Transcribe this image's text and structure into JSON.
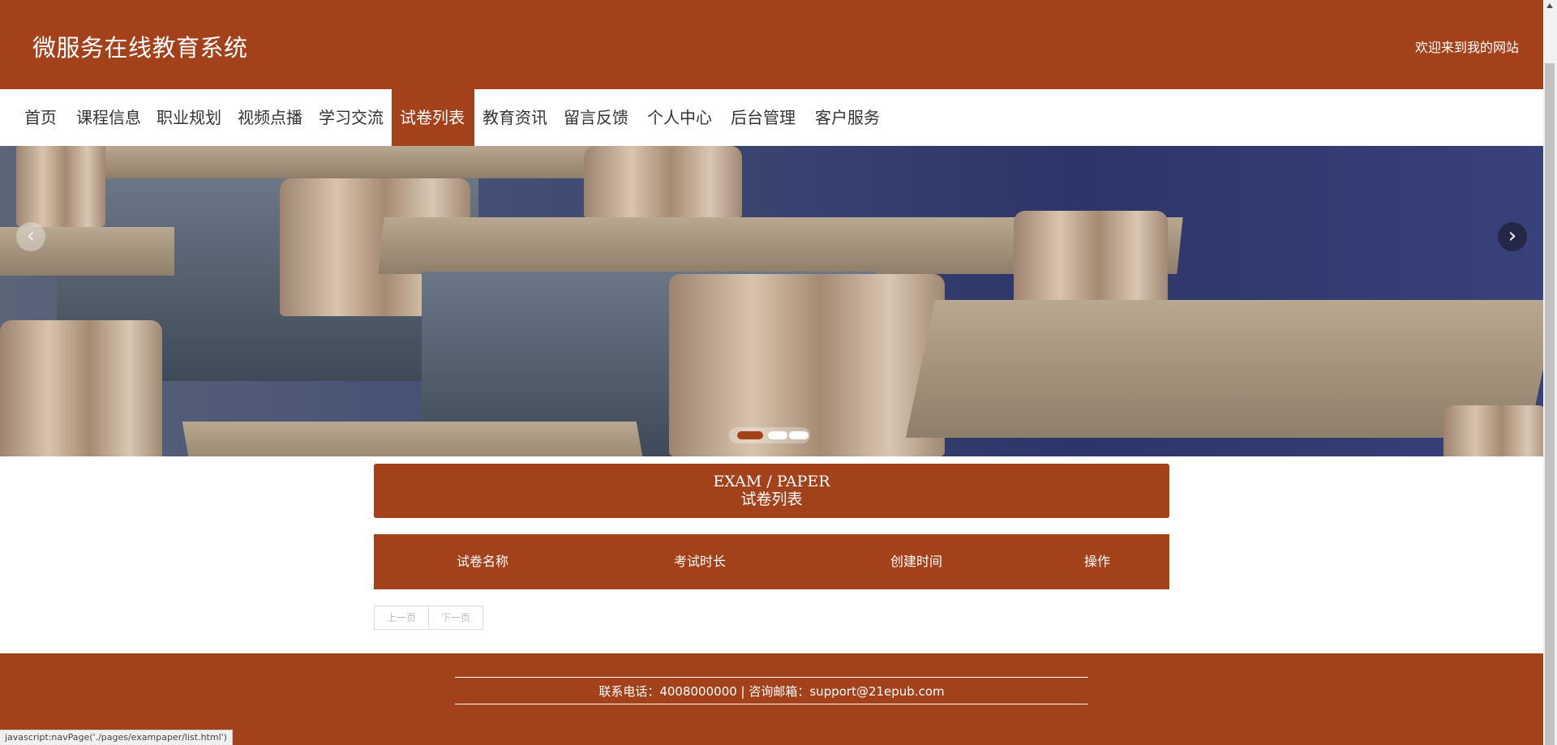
{
  "header": {
    "site_title": "微服务在线教育系统",
    "welcome": "欢迎来到我的网站"
  },
  "nav": {
    "items": [
      {
        "label": "首页"
      },
      {
        "label": "课程信息"
      },
      {
        "label": "职业规划"
      },
      {
        "label": "视频点播"
      },
      {
        "label": "学习交流"
      },
      {
        "label": "试卷列表",
        "active": true
      },
      {
        "label": "教育资讯"
      },
      {
        "label": "留言反馈"
      },
      {
        "label": "个人中心"
      },
      {
        "label": "后台管理"
      },
      {
        "label": "客户服务"
      }
    ]
  },
  "carousel": {
    "prev_icon": "chevron-left-icon",
    "next_icon": "chevron-right-icon",
    "prev_glyph": "‹",
    "next_glyph": "›",
    "slide_count": 3,
    "active_index": 0
  },
  "section": {
    "title_en": "EXAM / PAPER",
    "title_cn": "试卷列表"
  },
  "table": {
    "columns": [
      "试卷名称",
      "考试时长",
      "创建时间",
      "操作"
    ],
    "rows": []
  },
  "pager": {
    "prev": "上一页",
    "next": "下一页"
  },
  "footer": {
    "contact": "联系电话：4008000000 | 咨询邮箱：support@21epub.com"
  },
  "statusbar": {
    "url": "javascript:navPage('./pages/exampaper/list.html')"
  },
  "colors": {
    "brand": "#a2411a",
    "white": "#ffffff"
  }
}
